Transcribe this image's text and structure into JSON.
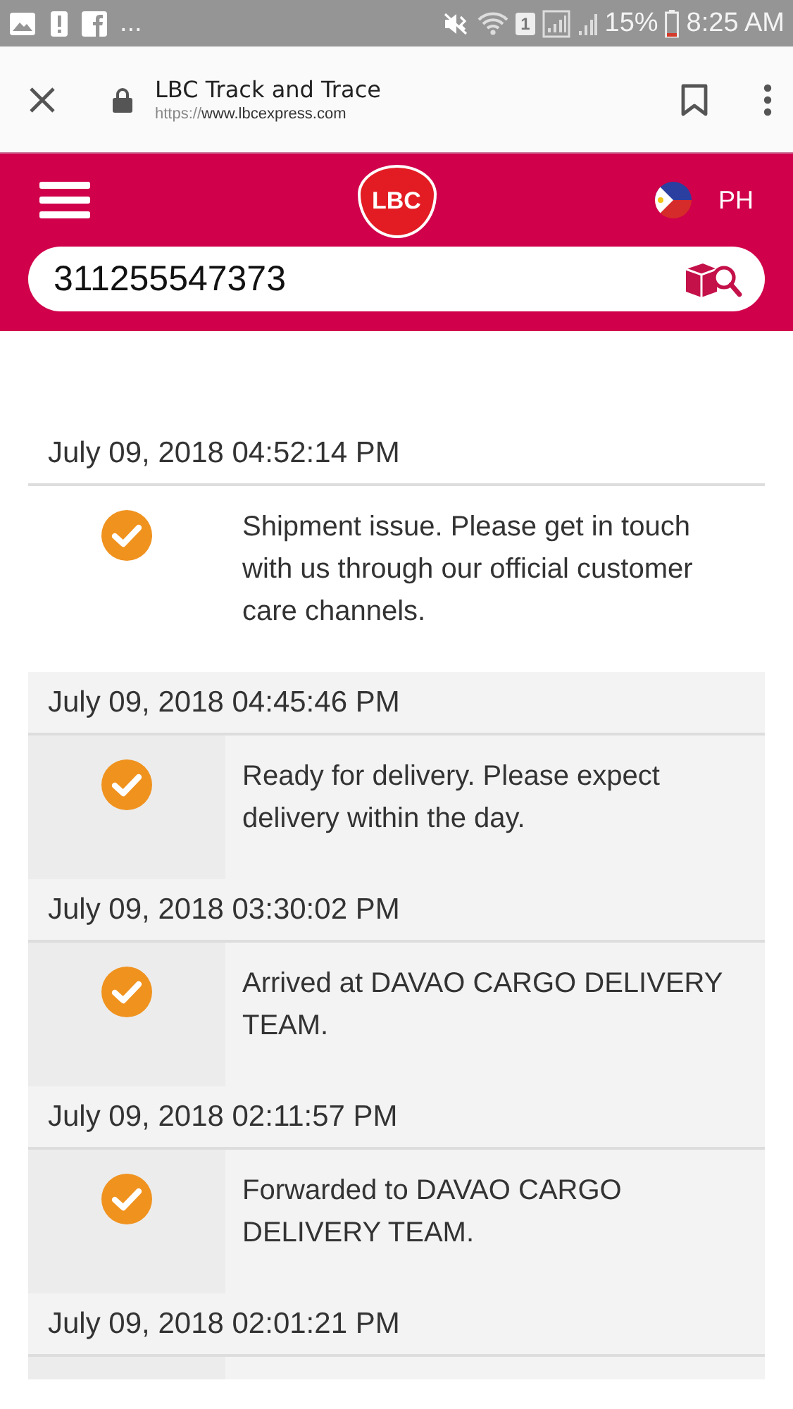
{
  "status_bar": {
    "overflow": "...",
    "sim_slot": "1",
    "battery": "15%",
    "time": "8:25 AM"
  },
  "browser": {
    "title": "LBC Track and Trace",
    "url_scheme": "https://",
    "url_host": "www.lbcexpress.com"
  },
  "header": {
    "logo": "LBC",
    "country": "PH"
  },
  "search": {
    "value": "311255547373"
  },
  "entries": [
    {
      "date": "July 09, 2018 04:52:14 PM",
      "shaded": false,
      "details": "Shipment issue. Please get in touch with us through our official customer care channels."
    },
    {
      "date": "July 09, 2018 04:45:46 PM",
      "shaded": true,
      "details": "Ready for delivery. Please expect delivery within the day."
    },
    {
      "date": "July 09, 2018 03:30:02 PM",
      "shaded": true,
      "details": "Arrived at DAVAO CARGO DELIVERY TEAM."
    },
    {
      "date": "July 09, 2018 02:11:57 PM",
      "shaded": true,
      "details": "Forwarded to DAVAO CARGO DELIVERY TEAM."
    },
    {
      "date": "July 09, 2018 02:01:21 PM",
      "shaded": true
    }
  ]
}
